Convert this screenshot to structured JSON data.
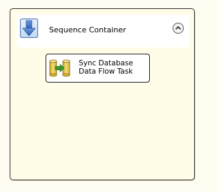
{
  "sequence_container": {
    "title": "Sequence Container",
    "icon": "sequence-container-icon",
    "collapse_icon": "collapse-chevron-up-icon"
  },
  "task": {
    "label_line1": "Sync Database",
    "label_line2": "Data Flow Task",
    "icon": "data-flow-task-icon"
  },
  "colors": {
    "canvas_background": "#fffdf2",
    "container_border": "#2b2b2b",
    "header_icon_blue": "#3a6fc4",
    "task_icon_gold": "#e8c640",
    "task_arrow_green": "#3a9a2a"
  }
}
